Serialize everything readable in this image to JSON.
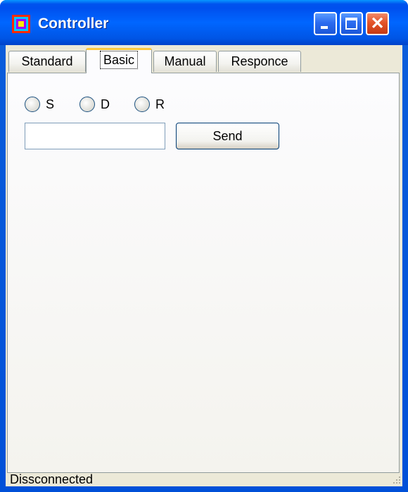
{
  "window": {
    "title": "Controller",
    "icon": "app-icon",
    "controls": [
      "minimize-icon",
      "maximize-icon",
      "close-icon"
    ]
  },
  "tabs": [
    {
      "label": "Standard"
    },
    {
      "label": "Basic",
      "selected": true
    },
    {
      "label": "Manual"
    },
    {
      "label": "Responce"
    }
  ],
  "panel": {
    "radios": [
      {
        "label": "S",
        "checked": false
      },
      {
        "label": "D",
        "checked": false
      },
      {
        "label": "R",
        "checked": false
      }
    ],
    "input": {
      "value": "",
      "placeholder": ""
    },
    "send_label": "Send"
  },
  "status": {
    "text": "Dissconnected"
  }
}
